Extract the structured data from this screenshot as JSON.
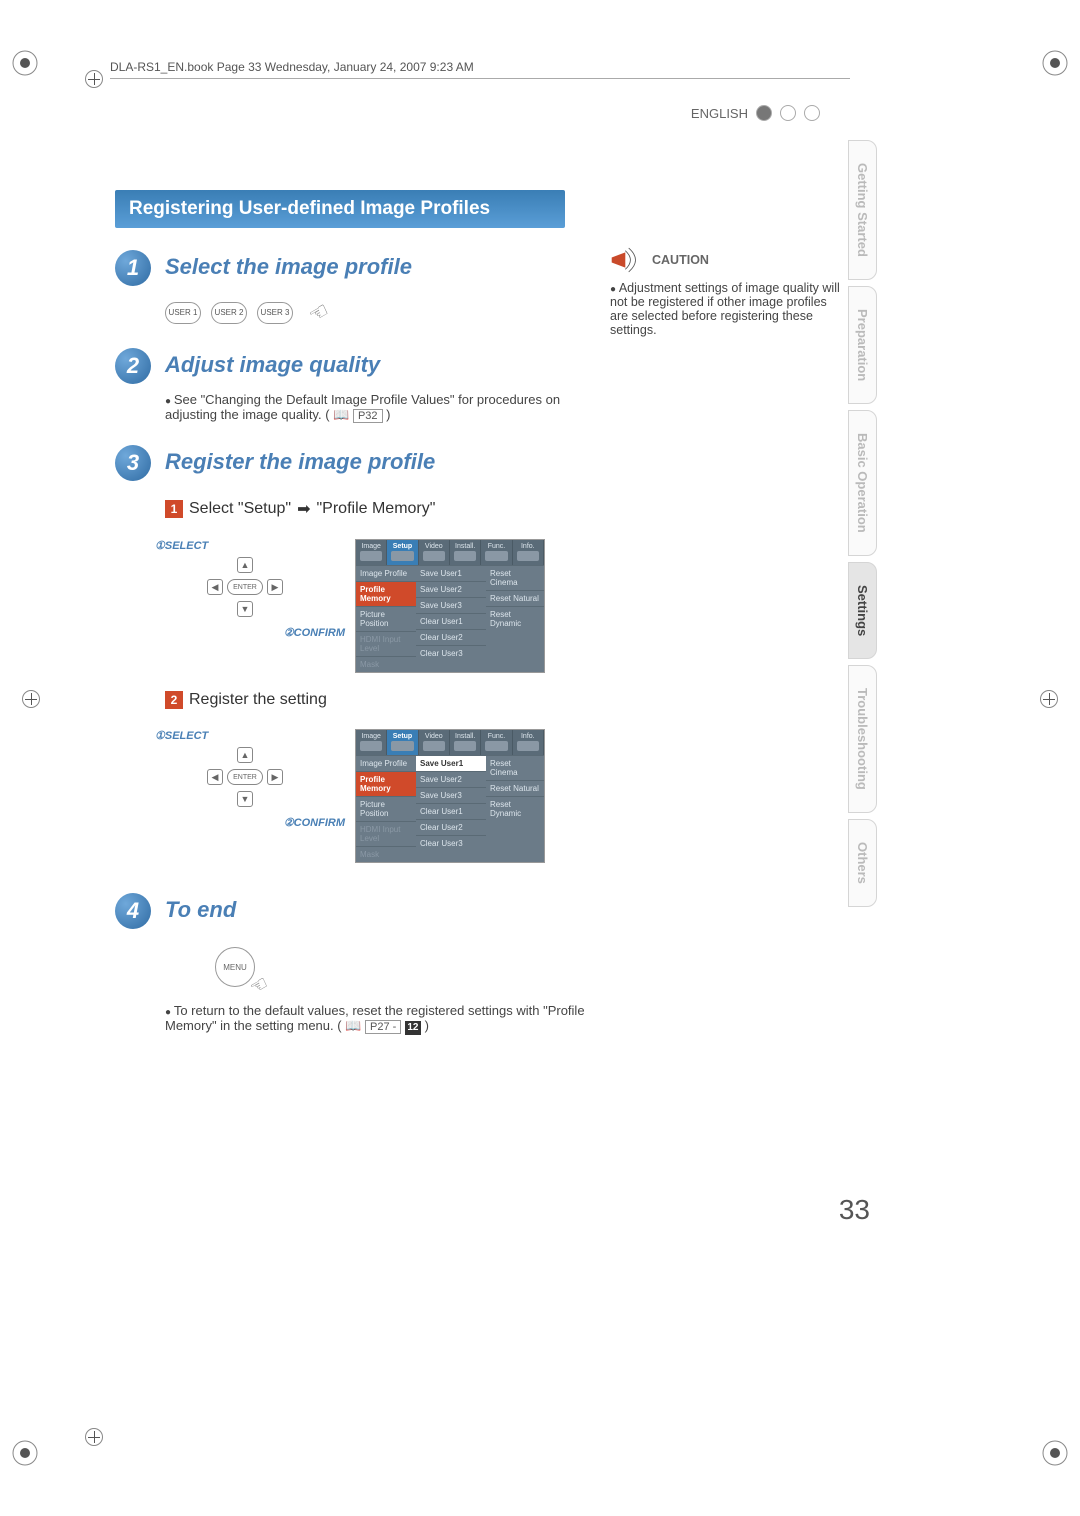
{
  "header": {
    "runner": "DLA-RS1_EN.book  Page 33  Wednesday, January 24, 2007  9:23 AM",
    "language": "ENGLISH"
  },
  "banner_title": "Registering User-defined Image Profiles",
  "steps": {
    "s1": {
      "num": "1",
      "title": "Select the image profile",
      "user_buttons": [
        "USER 1",
        "USER 2",
        "USER 3"
      ]
    },
    "s2": {
      "num": "2",
      "title": "Adjust image quality",
      "note": "See \"Changing the Default Image Profile Values\" for procedures on adjusting the image quality. (",
      "ref": "P32",
      "note_close": ")"
    },
    "s3": {
      "num": "3",
      "title": "Register the image profile",
      "sub1_prefix": "Select \"Setup\"",
      "sub1_suffix": "\"Profile Memory\"",
      "sub2": "Register the setting",
      "select_label": "①SELECT",
      "confirm_label": "②CONFIRM",
      "enter_label": "ENTER"
    },
    "s4": {
      "num": "4",
      "title": "To end",
      "menu_label": "MENU",
      "note": "To return to the default values, reset the registered settings with \"Profile Memory\" in the setting menu. (",
      "ref": "P27 - ",
      "ref2": "12",
      "note_close": ")"
    }
  },
  "osd": {
    "tabs": [
      "Image",
      "Setup",
      "Video",
      "Install.",
      "Func.",
      "Info."
    ],
    "left_rows": [
      "Image Profile",
      "Profile Memory",
      "Picture Position",
      "HDMI Input Level",
      "Mask"
    ],
    "mid_rows": [
      "Save User1",
      "Save User2",
      "Save User3",
      "Clear User1",
      "Clear User2",
      "Clear User3"
    ],
    "right_rows": [
      "Reset Cinema",
      "Reset Natural",
      "Reset Dynamic"
    ]
  },
  "caution": {
    "heading": "CAUTION",
    "text": "Adjustment settings of image quality will not be registered if other image profiles are selected before registering these settings."
  },
  "side_tabs": [
    "Getting Started",
    "Preparation",
    "Basic Operation",
    "Settings",
    "Troubleshooting",
    "Others"
  ],
  "page_number": "33"
}
